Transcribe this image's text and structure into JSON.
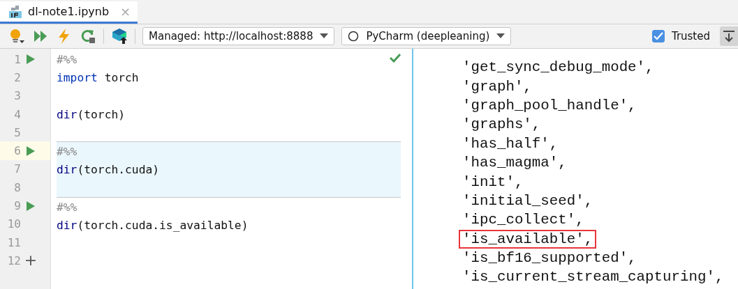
{
  "tab": {
    "title": "dl-note1.ipynb",
    "close": "×",
    "selected": true
  },
  "toolbar": {
    "server": "Managed: http://localhost:8888",
    "kernel": "PyCharm (deepleaning)",
    "trusted": {
      "label": "Trusted",
      "checked": true
    }
  },
  "editor": {
    "cells": [
      {
        "selected": false,
        "executed": true,
        "lines": [
          {
            "number": "1",
            "current": false,
            "tokens": [
              {
                "text": "#%%",
                "kind": "comment"
              }
            ]
          },
          {
            "number": "2",
            "current": false,
            "tokens": [
              {
                "text": "import",
                "kind": "keyword"
              },
              {
                "text": " torch",
                "kind": "plain"
              }
            ]
          },
          {
            "number": "3",
            "current": false
          },
          {
            "number": "4",
            "current": false,
            "tokens": [
              {
                "text": "dir",
                "kind": "builtin"
              },
              {
                "text": "(torch)",
                "kind": "plain"
              }
            ]
          },
          {
            "number": "5",
            "current": false
          }
        ]
      },
      {
        "selected": true,
        "executed": false,
        "lines": [
          {
            "number": "6",
            "current": true,
            "tokens": [
              {
                "text": "#%%",
                "kind": "comment"
              }
            ]
          },
          {
            "number": "7",
            "current": false,
            "tokens": [
              {
                "text": "dir",
                "kind": "builtin"
              },
              {
                "text": "(torch.cuda)",
                "kind": "plain"
              }
            ]
          },
          {
            "number": "8",
            "current": false
          }
        ]
      },
      {
        "selected": false,
        "executed": false,
        "lines": [
          {
            "number": "9",
            "current": false,
            "tokens": [
              {
                "text": "#%%",
                "kind": "comment"
              }
            ]
          },
          {
            "number": "10",
            "current": false,
            "tokens": [
              {
                "text": "dir",
                "kind": "builtin"
              },
              {
                "text": "(torch.cuda.is_available)",
                "kind": "plain"
              }
            ]
          },
          {
            "number": "11",
            "current": false
          }
        ]
      }
    ],
    "add_line": {
      "number": "12",
      "icon": "+"
    }
  },
  "output": {
    "lines": [
      {
        "text": "'get_sync_debug_mode',",
        "highlighted": false
      },
      {
        "text": "'graph',",
        "highlighted": false
      },
      {
        "text": "'graph_pool_handle',",
        "highlighted": false
      },
      {
        "text": "'graphs',",
        "highlighted": false
      },
      {
        "text": "'has_half',",
        "highlighted": false
      },
      {
        "text": "'has_magma',",
        "highlighted": false
      },
      {
        "text": "'init',",
        "highlighted": false
      },
      {
        "text": "'initial_seed',",
        "highlighted": false
      },
      {
        "text": "'ipc_collect',",
        "highlighted": false
      },
      {
        "text": "'is_available',",
        "highlighted": true
      },
      {
        "text": "'is_bf16_supported',",
        "highlighted": false
      },
      {
        "text": "'is_current_stream_capturing',",
        "highlighted": false
      }
    ]
  }
}
